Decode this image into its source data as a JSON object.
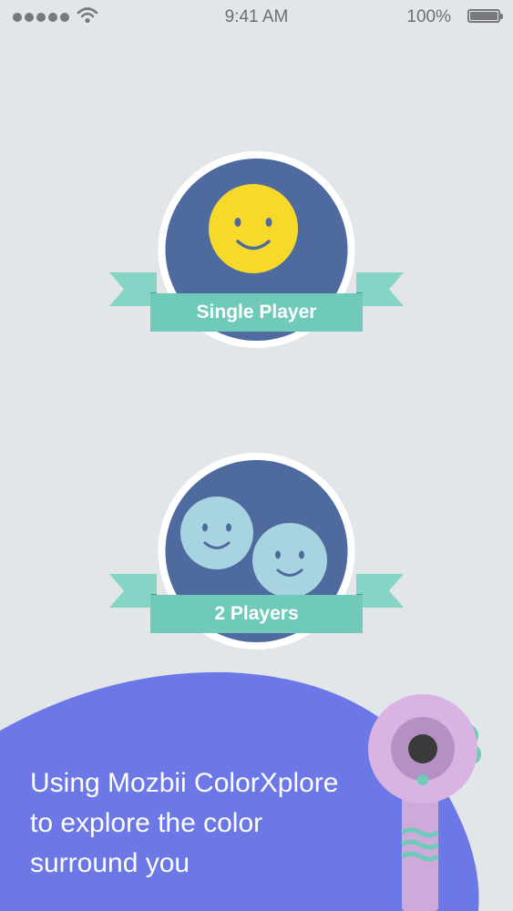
{
  "status_bar": {
    "time": "9:41 AM",
    "battery_percent": "100%",
    "signal_bars": 5
  },
  "modes": [
    {
      "label": "Single Player",
      "icon": "smiley-face-icon"
    },
    {
      "label": "2 Players",
      "icon": "two-smiley-faces-icon"
    }
  ],
  "promo": {
    "lines": [
      "Using Mozbii ColorXplore",
      "to explore the color",
      "surround you"
    ]
  },
  "colors": {
    "background": "#e2e6e9",
    "badge_circle": "#4e6a9f",
    "ribbon": "#6fcab9",
    "ribbon_dark": "#86d4c6",
    "smiley_single": "#f7d92a",
    "smiley_double": "#a8d4e2",
    "promo_panel": "#6b78e6",
    "device": "#cfa9d9"
  }
}
